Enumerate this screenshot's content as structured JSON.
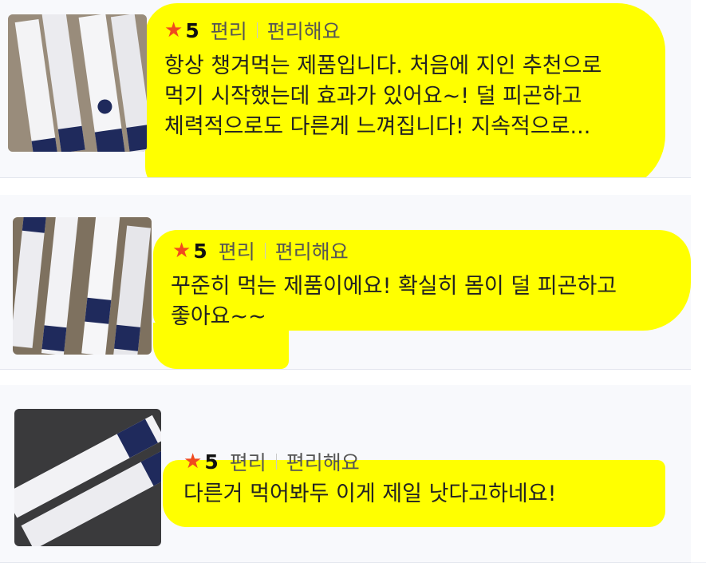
{
  "reviews": [
    {
      "rating_star": "★",
      "rating": "5",
      "option_label": "편리",
      "option_value": "편리해요",
      "lines": [
        "항상 챙겨먹는 제품입니다. 처음에 지인 추천으로",
        "먹기 시작했는데 효과가 있어요~! 덜 피곤하고",
        "체력적으로도 다른게 느껴집니다! 지속적으로..."
      ]
    },
    {
      "rating_star": "★",
      "rating": "5",
      "option_label": "편리",
      "option_value": "편리해요",
      "lines": [
        "꾸준히 먹는 제품이에요! 확실히 몸이 덜 피곤하고",
        "좋아요~~"
      ]
    },
    {
      "rating_star": "★",
      "rating": "5",
      "option_label": "편리",
      "option_value": "편리해요",
      "lines": [
        "다른거 먹어봐두 이게 제일 낫다고하네요!"
      ]
    }
  ],
  "colors": {
    "star": "#f04a1e",
    "highlight": "#ffff00",
    "card_bg": "#f8f9fc"
  },
  "icons": {
    "rating": "star-icon"
  }
}
